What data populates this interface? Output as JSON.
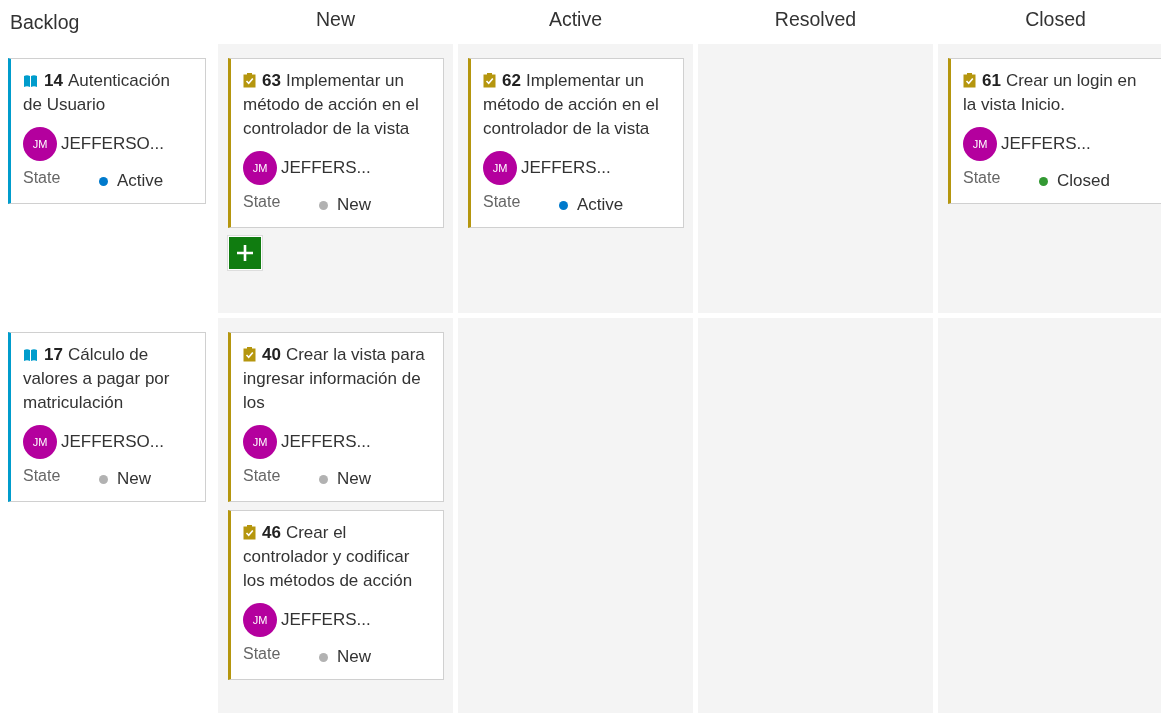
{
  "columns": [
    "Backlog",
    "New",
    "Active",
    "Resolved",
    "Closed"
  ],
  "lanes": [
    {
      "backlog": {
        "kind": "story",
        "id": "14",
        "title": "Autenticación de Usuario",
        "avatar": "JM",
        "assignee": "JEFFERSO...",
        "state_label": "State",
        "state": "Active",
        "color": "#007acc"
      },
      "cells": [
        {
          "cards": [
            {
              "kind": "task",
              "id": "63",
              "title": "Implementar un método de acción en el controlador de la vista",
              "avatar": "JM",
              "assignee": "JEFFERS...",
              "state_label": "State",
              "state": "New",
              "color": "#b2b2b2"
            }
          ],
          "add_button": true
        },
        {
          "cards": [
            {
              "kind": "task",
              "id": "62",
              "title": "Implementar un método de acción en el controlador de la vista",
              "avatar": "JM",
              "assignee": "JEFFERS...",
              "state_label": "State",
              "state": "Active",
              "color": "#007acc"
            }
          ],
          "add_button": false
        },
        {
          "add_button": false
        },
        {
          "cards": [
            {
              "kind": "task",
              "id": "61",
              "title": "Crear un login en la vista Inicio.",
              "avatar": "JM",
              "assignee": "JEFFERS...",
              "state_label": "State",
              "state": "Closed",
              "color": "#339933"
            }
          ],
          "add_button": false
        }
      ]
    },
    {
      "backlog": {
        "kind": "story",
        "id": "17",
        "title": "Cálculo de valores a pagar por matriculación",
        "avatar": "JM",
        "assignee": "JEFFERSO...",
        "state_label": "State",
        "state": "New",
        "color": "#b2b2b2"
      },
      "cells": [
        {
          "cards": [
            {
              "kind": "task",
              "id": "40",
              "title": "Crear la vista para ingresar información de los",
              "avatar": "JM",
              "assignee": "JEFFERS...",
              "state_label": "State",
              "state": "New",
              "color": "#b2b2b2"
            },
            {
              "kind": "task",
              "id": "46",
              "title": "Crear el controlador y codificar los métodos de acción",
              "avatar": "JM",
              "assignee": "JEFFERS...",
              "state_label": "State",
              "state": "New",
              "color": "#b2b2b2"
            }
          ],
          "add_button": false
        },
        {
          "add_button": false
        },
        {
          "add_button": false
        },
        {
          "add_button": false
        }
      ]
    }
  ]
}
